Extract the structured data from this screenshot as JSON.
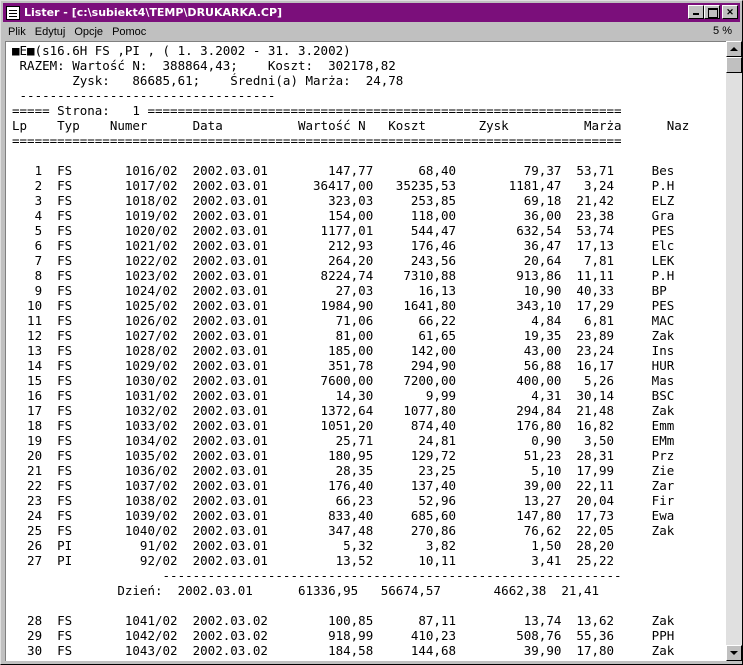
{
  "window": {
    "title": "Lister - [c:\\subiekt4\\TEMP\\DRUKARKA.CP]"
  },
  "menu": {
    "items": [
      "Plik",
      "Edytuj",
      "Opcje",
      "Pomoc"
    ],
    "zoom": "5 %"
  },
  "colors": {
    "titlebar": "#7b0f7b",
    "chrome": "#c0c0c0",
    "document": "#ffffff"
  },
  "document": {
    "lines": [
      "■E■(s16.6H FS ,PI , ( 1. 3.2002 - 31. 3.2002)",
      " RAZEM: Wartość N:  388864,43;    Koszt:  302178,82",
      "        Zysk:   86685,61;    Średni(a) Marża:  24,78",
      " ----------------------------------",
      "===== Strona:   1 ===============================================================",
      "Lp    Typ    Numer      Data          Wartość N   Koszt       Zysk          Marża      Naz",
      "=================================================================================",
      "",
      "   1  FS       1016/02  2002.03.01        147,77      68,40         79,37  53,71     Bes",
      "   2  FS       1017/02  2002.03.01      36417,00   35235,53       1181,47   3,24     P.H",
      "   3  FS       1018/02  2002.03.01        323,03     253,85         69,18  21,42     ELZ",
      "   4  FS       1019/02  2002.03.01        154,00     118,00         36,00  23,38     Gra",
      "   5  FS       1020/02  2002.03.01       1177,01     544,47        632,54  53,74     PES",
      "   6  FS       1021/02  2002.03.01        212,93     176,46         36,47  17,13     Elc",
      "   7  FS       1022/02  2002.03.01        264,20     243,56         20,64   7,81     LEK",
      "   8  FS       1023/02  2002.03.01       8224,74    7310,88        913,86  11,11     P.H",
      "   9  FS       1024/02  2002.03.01         27,03      16,13         10,90  40,33     BP",
      "  10  FS       1025/02  2002.03.01       1984,90    1641,80        343,10  17,29     PES",
      "  11  FS       1026/02  2002.03.01         71,06      66,22          4,84   6,81     MAC",
      "  12  FS       1027/02  2002.03.01         81,00      61,65         19,35  23,89     Zak",
      "  13  FS       1028/02  2002.03.01        185,00     142,00         43,00  23,24     Ins",
      "  14  FS       1029/02  2002.03.01        351,78     294,90         56,88  16,17     HUR",
      "  15  FS       1030/02  2002.03.01       7600,00    7200,00        400,00   5,26     Mas",
      "  16  FS       1031/02  2002.03.01         14,30       9,99          4,31  30,14     BSC",
      "  17  FS       1032/02  2002.03.01       1372,64    1077,80        294,84  21,48     Zak",
      "  18  FS       1033/02  2002.03.01       1051,20     874,40        176,80  16,82     Emm",
      "  19  FS       1034/02  2002.03.01         25,71      24,81          0,90   3,50     EMm",
      "  20  FS       1035/02  2002.03.01        180,95     129,72         51,23  28,31     Prz",
      "  21  FS       1036/02  2002.03.01         28,35      23,25          5,10  17,99     Zie",
      "  22  FS       1037/02  2002.03.01        176,40     137,40         39,00  22,11     Zar",
      "  23  FS       1038/02  2002.03.01         66,23      52,96         13,27  20,04     Fir",
      "  24  FS       1039/02  2002.03.01        833,40     685,60        147,80  17,73     Ewa",
      "  25  FS       1040/02  2002.03.01        347,48     270,86         76,62  22,05     Zak",
      "  26  PI         91/02  2002.03.01          5,32       3,82          1,50  28,20",
      "  27  PI         92/02  2002.03.01         13,52      10,11          3,41  25,22",
      "                    -------------------------------------------------------------",
      "              Dzień:  2002.03.01      61336,95   56674,57       4662,38  21,41",
      "",
      "  28  FS       1041/02  2002.03.02        100,85      87,11         13,74  13,62     Zak",
      "  29  FS       1042/02  2002.03.02        918,99     410,23        508,76  55,36     PPH",
      "  30  FS       1043/02  2002.03.02        184,58     144,68         39,90  17,80     Zak"
    ]
  }
}
